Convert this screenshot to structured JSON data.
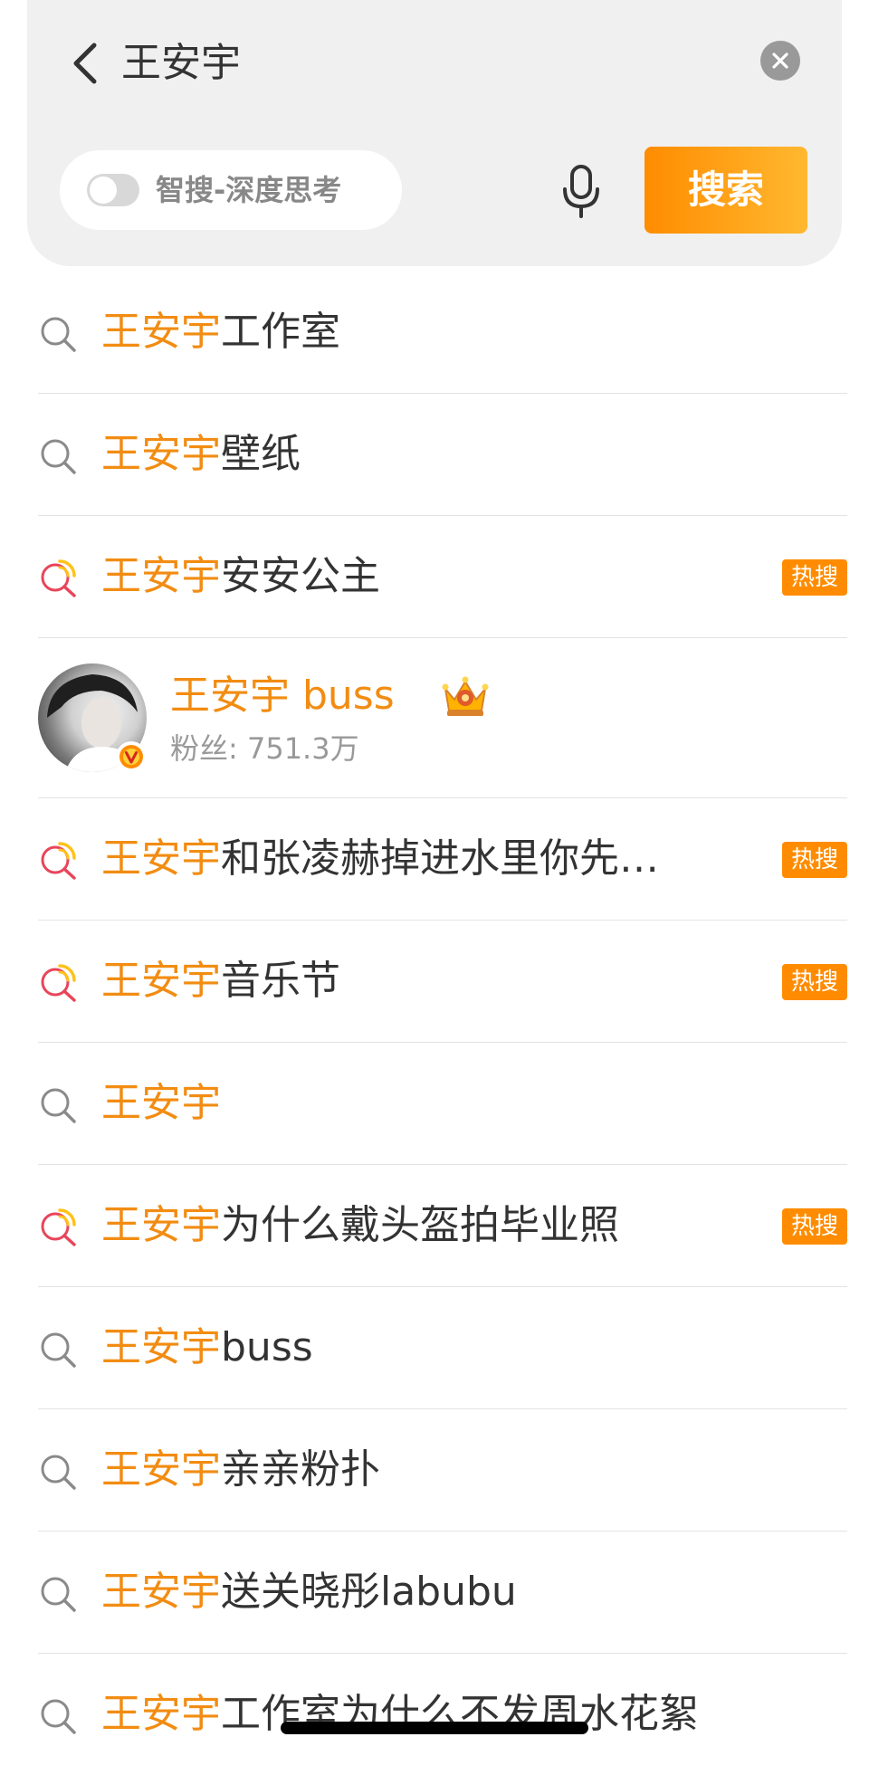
{
  "search": {
    "query": "王安宇",
    "smart_toggle_label": "智搜-深度思考",
    "smart_toggle_on": false,
    "search_button_label": "搜索"
  },
  "colors": {
    "highlight": "#f28c12",
    "hot_badge": "#ff8c00",
    "panel_bg": "#f0f0f0",
    "hot_icon_red": "#e8455a",
    "hot_icon_yellow": "#ffc21a"
  },
  "suggestions": [
    {
      "highlight": "王安宇",
      "rest": "工作室",
      "icon": "search-icon",
      "hot": false
    },
    {
      "highlight": "王安宇",
      "rest": "壁纸",
      "icon": "search-icon",
      "hot": false
    },
    {
      "highlight": "王安宇",
      "rest": "安安公主",
      "icon": "hot-search-icon",
      "hot": true,
      "badge": "热搜"
    },
    {
      "type": "user",
      "name": "王安宇 buss",
      "fans_label": "粉丝:",
      "fans_value": "751.3万",
      "avatar": "avatar-photo",
      "verified_icon": "verified-v-icon",
      "level_icon": "crown-icon"
    },
    {
      "highlight": "王安宇",
      "rest": "和张凌赫掉进水里你先…",
      "icon": "hot-search-icon",
      "hot": true,
      "badge": "热搜"
    },
    {
      "highlight": "王安宇",
      "rest": "音乐节",
      "icon": "hot-search-icon",
      "hot": true,
      "badge": "热搜"
    },
    {
      "highlight": "王安宇",
      "rest": "",
      "icon": "search-icon",
      "hot": false
    },
    {
      "highlight": "王安宇",
      "rest": "为什么戴头盔拍毕业照",
      "icon": "hot-search-icon",
      "hot": true,
      "badge": "热搜"
    },
    {
      "highlight": "王安宇",
      "rest": "buss",
      "icon": "search-icon",
      "hot": false
    },
    {
      "highlight": "王安宇",
      "rest": "亲亲粉扑",
      "icon": "search-icon",
      "hot": false
    },
    {
      "highlight": "王安宇",
      "rest": "送关晓彤labubu",
      "icon": "search-icon",
      "hot": false
    },
    {
      "highlight": "王安宇",
      "rest": "工作室为什么不发周水花絮",
      "icon": "search-icon",
      "hot": false
    }
  ]
}
